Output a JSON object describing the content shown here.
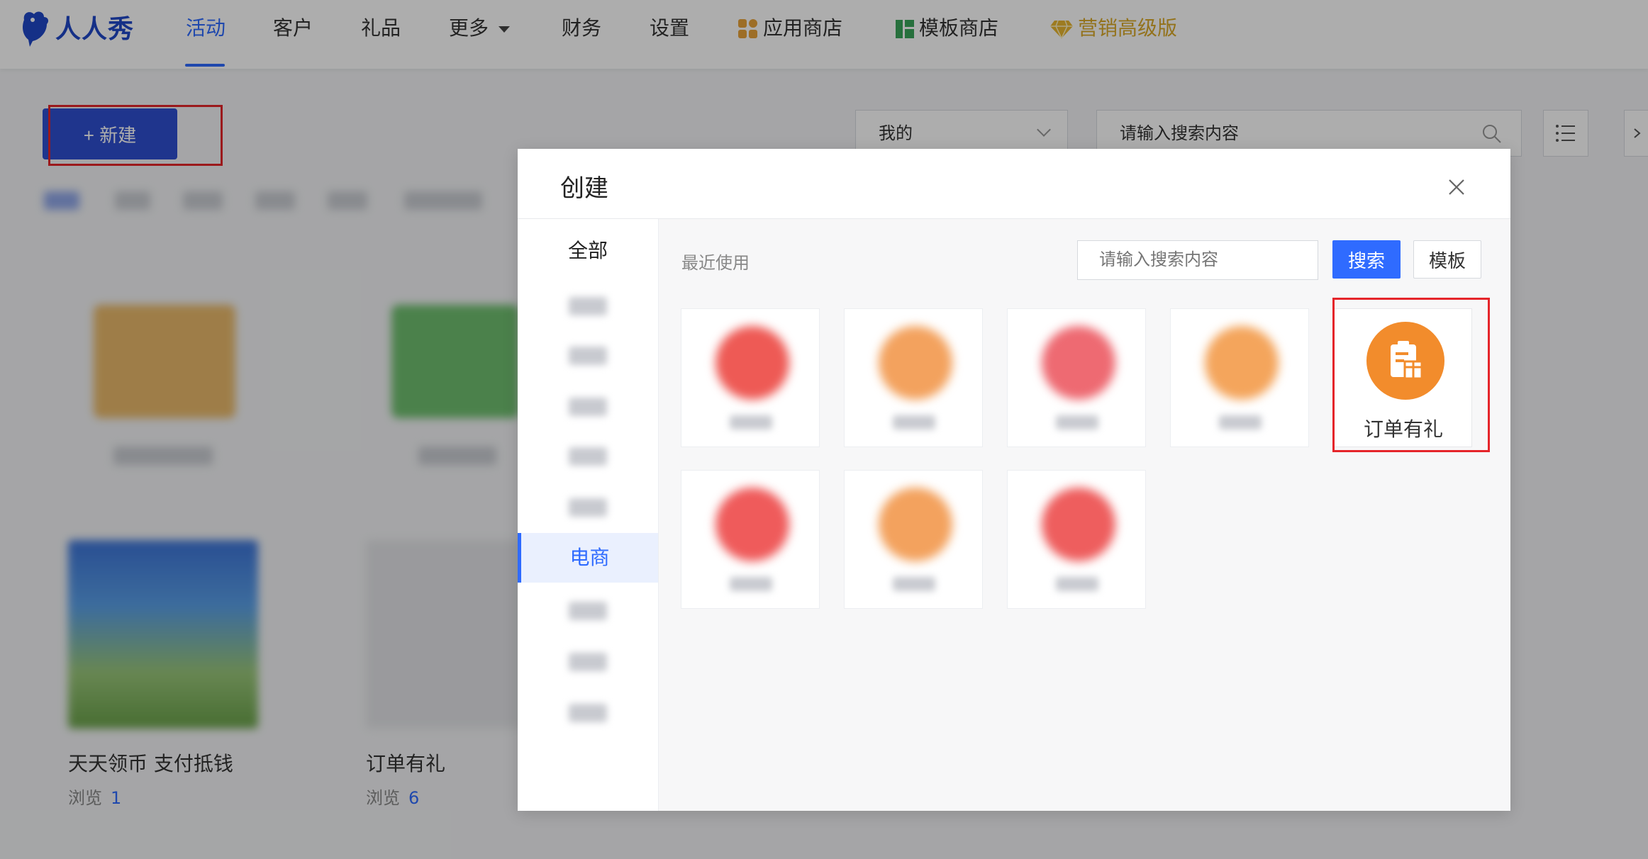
{
  "nav": {
    "logo_text": "人人秀",
    "items": [
      {
        "label": "活动"
      },
      {
        "label": "客户"
      },
      {
        "label": "礼品"
      },
      {
        "label": "更多"
      },
      {
        "label": "财务"
      },
      {
        "label": "设置"
      },
      {
        "label": "应用商店"
      },
      {
        "label": "模板商店"
      },
      {
        "label": "营销高级版"
      }
    ],
    "accent_color": "#2f6bff",
    "gold_color": "#d9a928"
  },
  "toolbar": {
    "new_button": "+ 新建",
    "filter_select_value": "我的",
    "search_placeholder": "请输入搜索内容"
  },
  "cards": [
    {
      "title": "天天领币 支付抵钱",
      "views_label": "浏览",
      "views": "1"
    },
    {
      "title": "订单有礼",
      "views_label": "浏览",
      "views": "6"
    }
  ],
  "modal": {
    "title": "创建",
    "sidebar": {
      "all_label": "全部",
      "active_label": "电商"
    },
    "recent_label": "最近使用",
    "search_placeholder": "请输入搜索内容",
    "search_button": "搜索",
    "template_button": "模板",
    "highlighted_tile": {
      "label": "订单有礼",
      "icon": "gift-order-icon",
      "color": "#f28c2c"
    }
  },
  "highlight_color": "#e5252a"
}
